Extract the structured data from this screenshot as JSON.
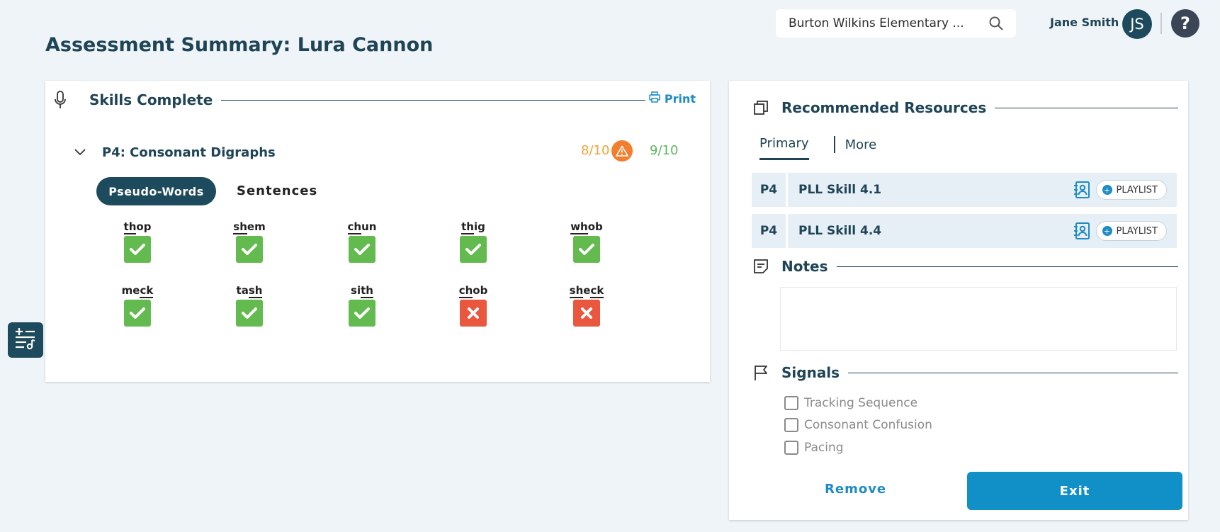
{
  "header": {
    "school": "Burton Wilkins Elementary ...",
    "user_name": "Jane Smith",
    "avatar_initials": "JS",
    "help": "?"
  },
  "page_title": "Assessment Summary: Lura Cannon",
  "skills_card": {
    "title": "Skills Complete",
    "print_label": "Print",
    "skill_name": "P4: Consonant Digraphs",
    "score_a": "8/10",
    "score_b": "9/10",
    "tab_active": "Pseudo-Words",
    "tab_other": "Sentences",
    "words": [
      {
        "pre": "",
        "u": "th",
        "post": "op",
        "result": "correct"
      },
      {
        "pre": "",
        "u": "sh",
        "post": "em",
        "result": "correct"
      },
      {
        "pre": "",
        "u": "ch",
        "post": "un",
        "result": "correct"
      },
      {
        "pre": "",
        "u": "th",
        "post": "ig",
        "result": "correct"
      },
      {
        "pre": "",
        "u": "wh",
        "post": "ob",
        "result": "correct"
      },
      {
        "pre": "me",
        "u": "ck",
        "post": "",
        "result": "correct"
      },
      {
        "pre": "ta",
        "u": "sh",
        "post": "",
        "result": "correct"
      },
      {
        "pre": "si",
        "u": "th",
        "post": "",
        "result": "correct"
      },
      {
        "pre": "",
        "u": "ch",
        "post": "ob",
        "result": "incorrect"
      },
      {
        "pre": "",
        "u": "sh",
        "post": "e",
        "u2": "ck",
        "result": "incorrect"
      }
    ]
  },
  "resources_card": {
    "title": "Recommended Resources",
    "tabs": [
      "Primary",
      "More"
    ],
    "items": [
      {
        "code": "P4",
        "label": "PLL Skill 4.1",
        "action": "PLAYLIST"
      },
      {
        "code": "P4",
        "label": "PLL Skill 4.4",
        "action": "PLAYLIST"
      }
    ],
    "notes_title": "Notes",
    "notes_value": "",
    "signals_title": "Signals",
    "signals": [
      "Tracking Sequence",
      "Consonant Confusion",
      "Pacing"
    ],
    "remove_label": "Remove",
    "exit_label": "Exit"
  },
  "colors": {
    "primary_dark": "#1d4a5c",
    "accent_blue": "#1190c8",
    "correct": "#63bb4f",
    "incorrect": "#e8573e",
    "warning": "#f07f2e"
  }
}
